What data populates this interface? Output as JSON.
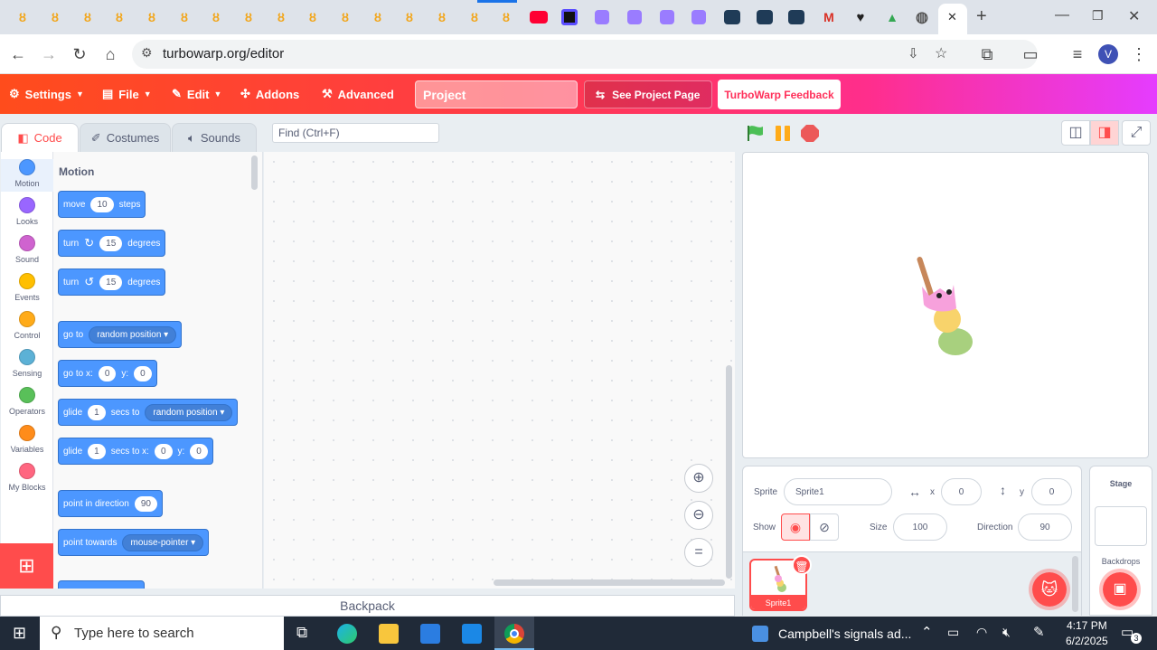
{
  "browser": {
    "url": "turbowarp.org/editor",
    "tab_close": "✕",
    "new_tab": "+",
    "profile_initial": "V"
  },
  "menubar": {
    "settings": "Settings",
    "file": "File",
    "edit": "Edit",
    "addons": "Addons",
    "advanced": "Advanced",
    "project_title": "Project",
    "see_project_page": "See Project Page",
    "feedback": "TurboWarp Feedback"
  },
  "editor_tabs": {
    "code": "Code",
    "costumes": "Costumes",
    "sounds": "Sounds"
  },
  "find_placeholder": "Find (Ctrl+F)",
  "categories": [
    {
      "label": "Motion",
      "color": "#4c97ff"
    },
    {
      "label": "Looks",
      "color": "#9966ff"
    },
    {
      "label": "Sound",
      "color": "#cf63cf"
    },
    {
      "label": "Events",
      "color": "#ffbf00"
    },
    {
      "label": "Control",
      "color": "#ffab19"
    },
    {
      "label": "Sensing",
      "color": "#5cb1d6"
    },
    {
      "label": "Operators",
      "color": "#59c059"
    },
    {
      "label": "Variables",
      "color": "#ff8c1a"
    },
    {
      "label": "My Blocks",
      "color": "#ff6680"
    }
  ],
  "palette": {
    "heading": "Motion",
    "move": {
      "a": "move",
      "v": "10",
      "b": "steps"
    },
    "turn_right": {
      "a": "turn",
      "v": "15",
      "b": "degrees"
    },
    "turn_left": {
      "a": "turn",
      "v": "15",
      "b": "degrees"
    },
    "goto": {
      "a": "go to",
      "d": "random position"
    },
    "goto_xy": {
      "a": "go to x:",
      "x": "0",
      "yl": "y:",
      "y": "0"
    },
    "glide": {
      "a": "glide",
      "v": "1",
      "b": "secs to",
      "d": "random position"
    },
    "glide_xy": {
      "a": "glide",
      "v": "1",
      "b": "secs to x:",
      "x": "0",
      "yl": "y:",
      "y": "0"
    },
    "point_dir": {
      "a": "point in direction",
      "v": "90"
    },
    "point_towards": {
      "a": "point towards",
      "d": "mouse-pointer"
    }
  },
  "backpack": "Backpack",
  "sprite_info": {
    "sprite_label": "Sprite",
    "sprite_name": "Sprite1",
    "x_label": "x",
    "x": "0",
    "y_label": "y",
    "y": "0",
    "show_label": "Show",
    "size_label": "Size",
    "size": "100",
    "direction_label": "Direction",
    "direction": "90"
  },
  "sprite_tile": "Sprite1",
  "stage_pane": {
    "title": "Stage",
    "backdrops": "Backdrops"
  },
  "taskbar": {
    "search_placeholder": "Type here to search",
    "notification": "Campbell's signals ad...",
    "time": "4:17 PM",
    "date": "6/2/2025",
    "badge": "3"
  }
}
